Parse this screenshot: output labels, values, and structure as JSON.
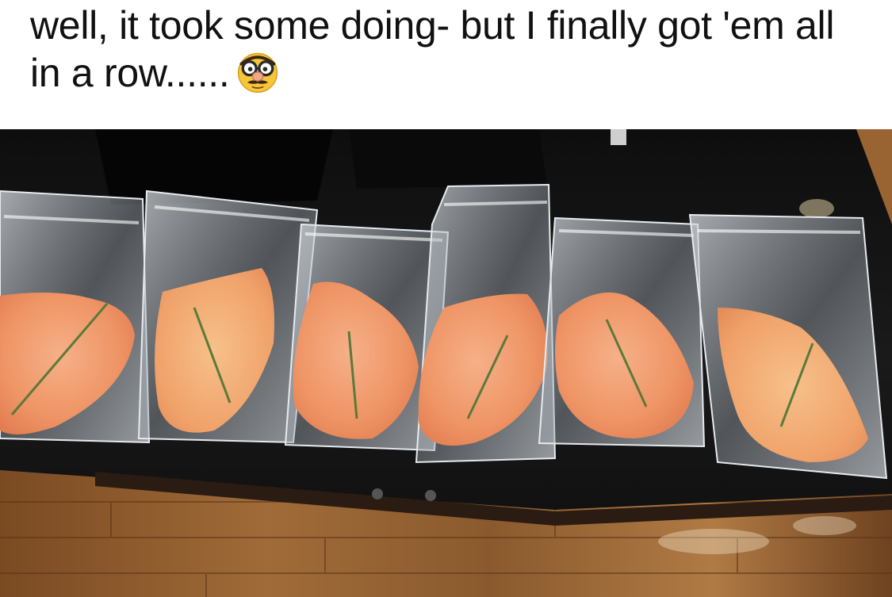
{
  "post": {
    "text": "well, it took some doing- but I finally got 'em all in a row......",
    "emoji": "disguised-face-emoji"
  },
  "photo": {
    "subject": "six vacuum-sealed bags on a black countertop",
    "bag_count": 6
  },
  "colors": {
    "counter": "#141414",
    "floor": "#8a5a2e",
    "meat": "#f0a070",
    "background": "#ffffff"
  }
}
